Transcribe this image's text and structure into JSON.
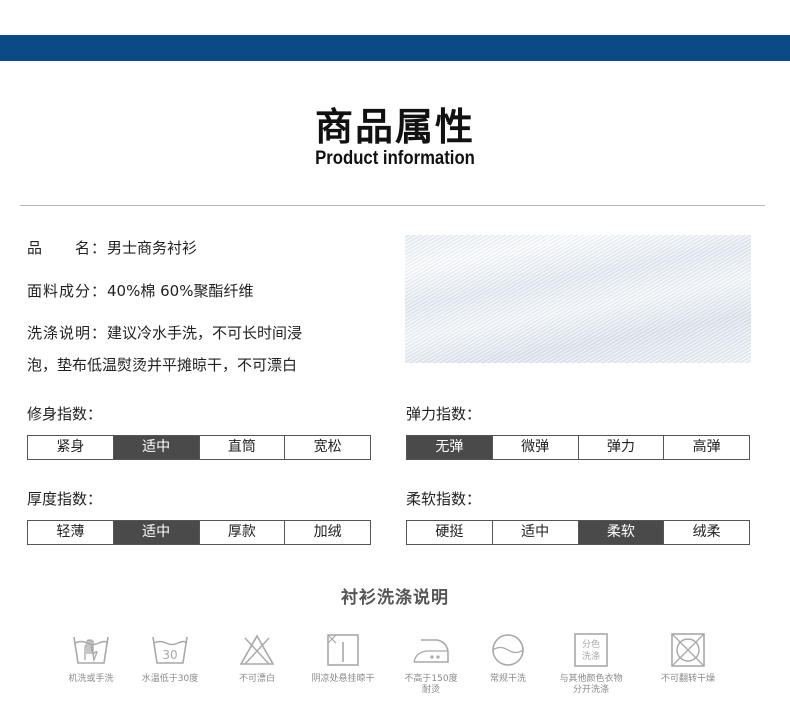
{
  "header": {
    "title_cn": "商品属性",
    "title_en": "Product information"
  },
  "info": {
    "name_label": "品　　名：",
    "name_value": "男士商务衬衫",
    "material_label": "面料成分：",
    "material_value": "40%棉  60%聚酯纤维",
    "wash_label": "洗涤说明：",
    "wash_value_line1": "建议冷水手洗，不可长时间浸",
    "wash_value_line2": "泡，垫布低温熨烫并平摊晾干，不可漂白"
  },
  "scales": {
    "fit": {
      "label": "修身指数：",
      "options": [
        "紧身",
        "适中",
        "直筒",
        "宽松"
      ],
      "selected": 1
    },
    "elasticity": {
      "label": "弹力指数：",
      "options": [
        "无弹",
        "微弹",
        "弹力",
        "高弹"
      ],
      "selected": 0
    },
    "thickness": {
      "label": "厚度指数：",
      "options": [
        "轻薄",
        "适中",
        "厚款",
        "加绒"
      ],
      "selected": 1
    },
    "softness": {
      "label": "柔软指数：",
      "options": [
        "硬挺",
        "适中",
        "柔软",
        "绒柔"
      ],
      "selected": 2
    }
  },
  "care": {
    "title": "衬衫洗涤说明",
    "items": [
      {
        "icon": "hand-wash-icon",
        "label": "机洗或手洗"
      },
      {
        "icon": "wash-30-icon",
        "label": "水温低于30度",
        "icon_text": "30"
      },
      {
        "icon": "no-bleach-icon",
        "label": "不可漂白"
      },
      {
        "icon": "line-dry-shade-icon",
        "label": "阴凉处悬挂晾干"
      },
      {
        "icon": "iron-150-icon",
        "label": "不高于150度",
        "label2": "耐烫"
      },
      {
        "icon": "dry-clean-icon",
        "label": "常规干洗"
      },
      {
        "icon": "separate-wash-icon",
        "label": "与其他颜色衣物",
        "label2": "分开洗涤",
        "icon_text1": "分色",
        "icon_text2": "洗涤"
      },
      {
        "icon": "no-tumble-dry-icon",
        "label": "不可翻转干燥"
      }
    ]
  },
  "colors": {
    "top_bar": "#0b4a86",
    "active_cell": "#4a4a4a",
    "icon_gray": "#a8a8a8"
  }
}
